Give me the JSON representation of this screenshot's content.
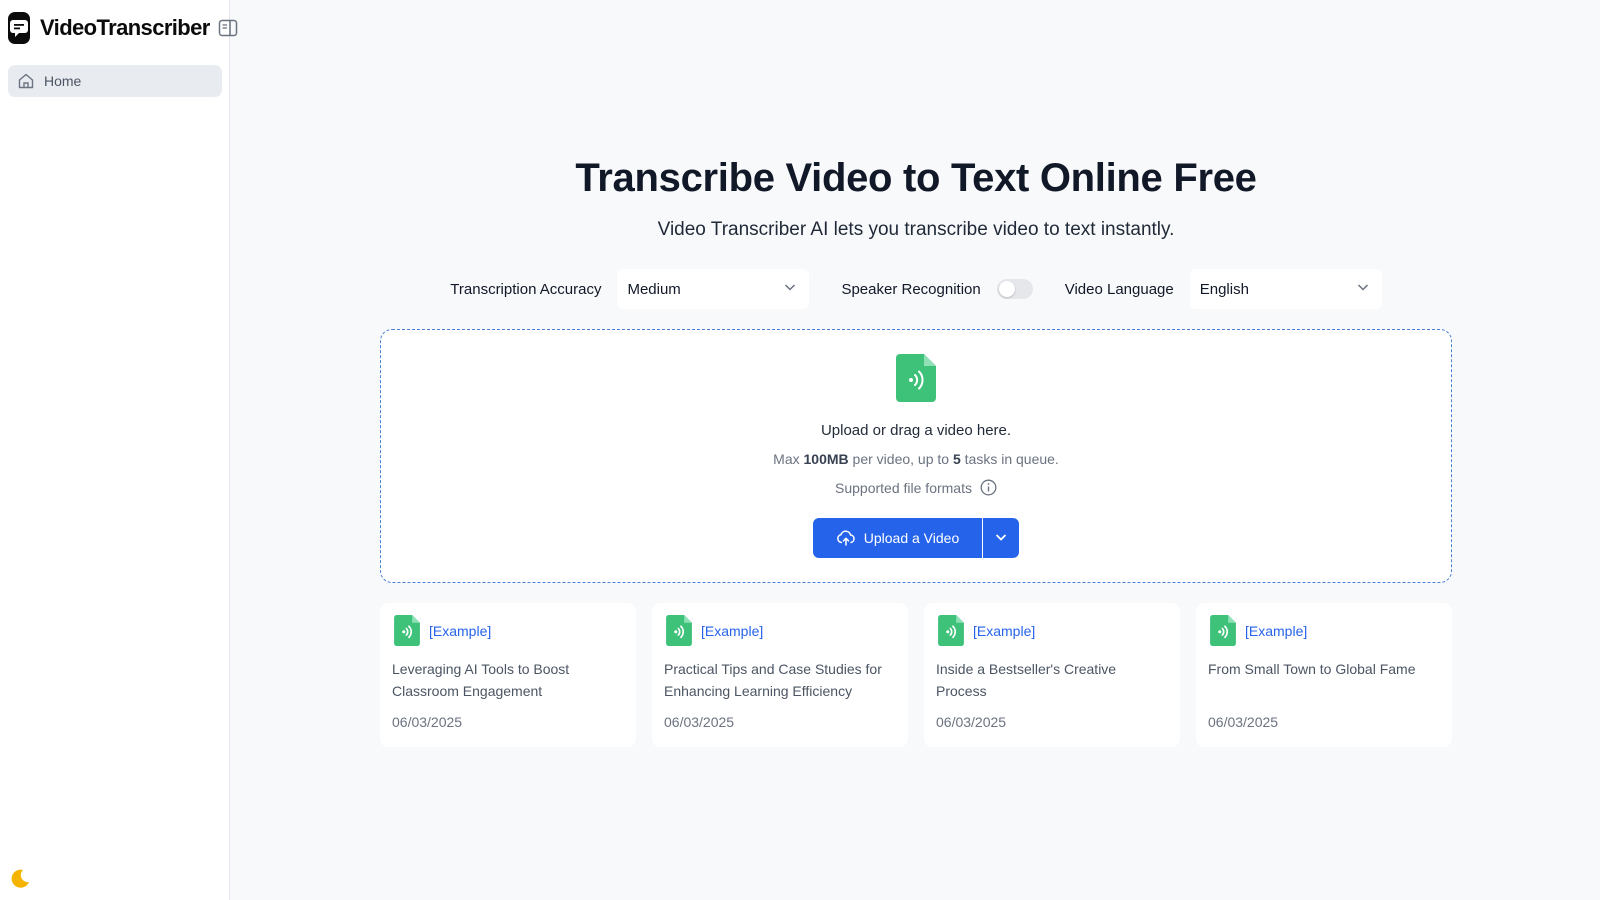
{
  "app": {
    "name": "VideoTranscriber"
  },
  "sidebar": {
    "items": [
      {
        "label": "Home",
        "icon": "home-icon"
      }
    ]
  },
  "hero": {
    "title": "Transcribe Video to Text Online Free",
    "subtitle": "Video Transcriber AI lets you transcribe video to text instantly."
  },
  "options": {
    "accuracy_label": "Transcription Accuracy",
    "accuracy_value": "Medium",
    "speaker_label": "Speaker Recognition",
    "speaker_enabled": false,
    "language_label": "Video Language",
    "language_value": "English"
  },
  "upload": {
    "prompt": "Upload or drag a video here.",
    "limit_prefix": "Max ",
    "max_size": "100MB",
    "limit_middle": " per video, up to ",
    "max_tasks": "5",
    "limit_suffix": " tasks in queue.",
    "formats_label": "Supported file formats",
    "button_label": "Upload a Video"
  },
  "examples": [
    {
      "tag": "[Example]",
      "title": "Leveraging AI Tools to Boost Classroom Engagement",
      "date": "06/03/2025"
    },
    {
      "tag": "[Example]",
      "title": "Practical Tips and Case Studies for Enhancing Learning Efficiency",
      "date": "06/03/2025"
    },
    {
      "tag": "[Example]",
      "title": "Inside a Bestseller's Creative Process",
      "date": "06/03/2025"
    },
    {
      "tag": "[Example]",
      "title": "From Small Town to Global Fame",
      "date": "06/03/2025"
    }
  ],
  "colors": {
    "accent": "#2563eb",
    "file_icon": "#3ec27a",
    "theme_icon": "#f5b400"
  }
}
